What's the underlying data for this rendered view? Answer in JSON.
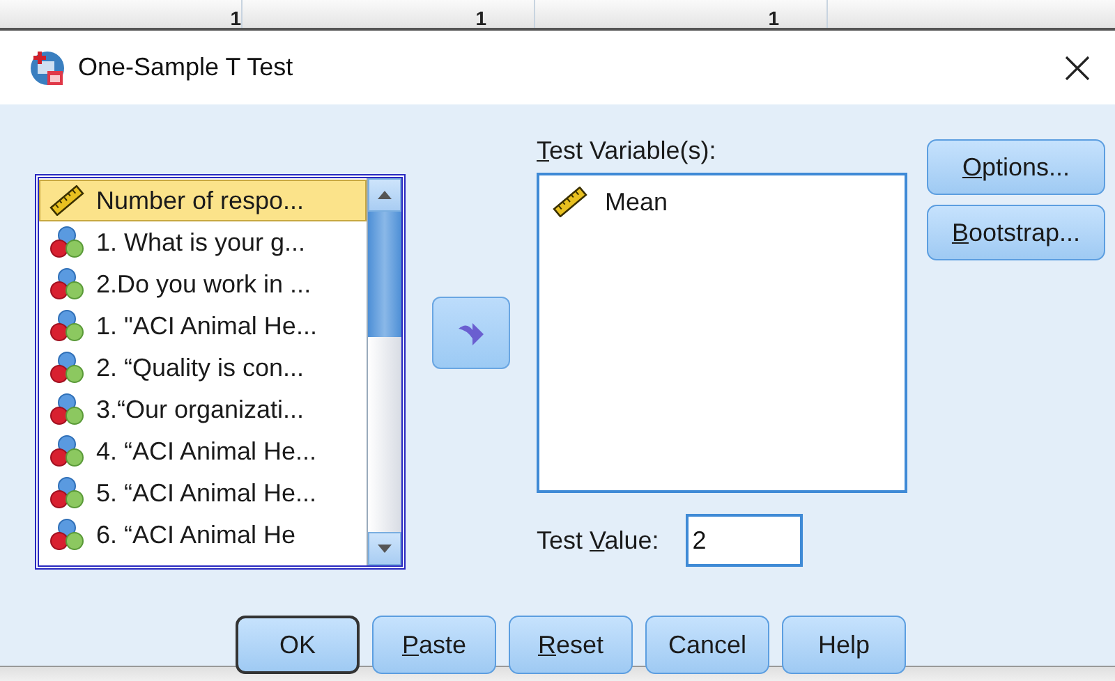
{
  "background_sheet": {
    "top_cells": [
      "1",
      "1",
      "1"
    ]
  },
  "window": {
    "title": "One-Sample T Test"
  },
  "variable_list": {
    "items": [
      {
        "kind": "scale",
        "label": "Number of respo...",
        "selected": true
      },
      {
        "kind": "nominal",
        "label": "1. What is your g...",
        "selected": false
      },
      {
        "kind": "nominal",
        "label": "2.Do you work in ...",
        "selected": false
      },
      {
        "kind": "nominal",
        "label": "1. \"ACI Animal He...",
        "selected": false
      },
      {
        "kind": "nominal",
        "label": "2. “Quality is con...",
        "selected": false
      },
      {
        "kind": "nominal",
        "label": "3.“Our organizati...",
        "selected": false
      },
      {
        "kind": "nominal",
        "label": "4. “ACI Animal He...",
        "selected": false
      },
      {
        "kind": "nominal",
        "label": "5. “ACI Animal He...",
        "selected": false
      },
      {
        "kind": "nominal",
        "label": "6. “ACI Animal He",
        "selected": false
      }
    ]
  },
  "test_variables": {
    "label": {
      "key": "T",
      "post": "est Variable(s):"
    },
    "items": [
      {
        "kind": "scale",
        "label": "Mean"
      }
    ]
  },
  "test_value": {
    "label": {
      "pre": "Test ",
      "key": "V",
      "post": "alue:"
    },
    "value": "2"
  },
  "side_buttons": [
    {
      "key": "O",
      "post": "ptions..."
    },
    {
      "key": "B",
      "post": "ootstrap..."
    }
  ],
  "buttons": [
    {
      "pre": "OK",
      "default": true
    },
    {
      "key": "P",
      "post": "aste",
      "default": false
    },
    {
      "key": "R",
      "post": "eset",
      "default": false
    },
    {
      "pre": "Cancel",
      "default": false
    },
    {
      "pre": "Help",
      "default": false
    }
  ]
}
